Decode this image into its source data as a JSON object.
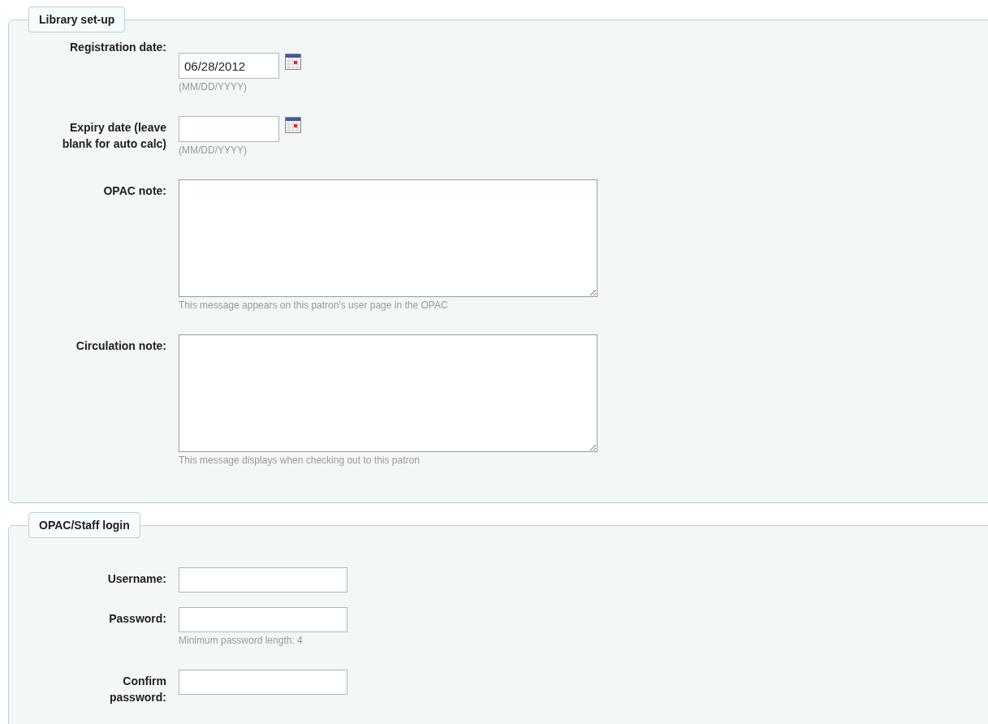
{
  "sections": [
    {
      "title": "Library set-up",
      "fields": [
        {
          "kind": "date",
          "label": "Registration date:",
          "value": "06/28/2012",
          "hint": "(MM/DD/YYYY)"
        },
        {
          "kind": "date",
          "label": "Expiry date (leave blank for auto calc)",
          "hint": "(MM/DD/YYYY)"
        },
        {
          "kind": "textarea",
          "label": "OPAC note:",
          "hint": "This message appears on this patron's user page in the OPAC"
        },
        {
          "kind": "textarea",
          "label": "Circulation note:",
          "hint": "This message displays when checking out to this patron"
        }
      ]
    },
    {
      "title": "OPAC/Staff login",
      "fields": [
        {
          "kind": "text",
          "label": "Username:"
        },
        {
          "kind": "password",
          "label": "Password:",
          "hint": "Minimum password length: 4"
        },
        {
          "kind": "password",
          "label": "Confirm password:"
        }
      ]
    }
  ]
}
